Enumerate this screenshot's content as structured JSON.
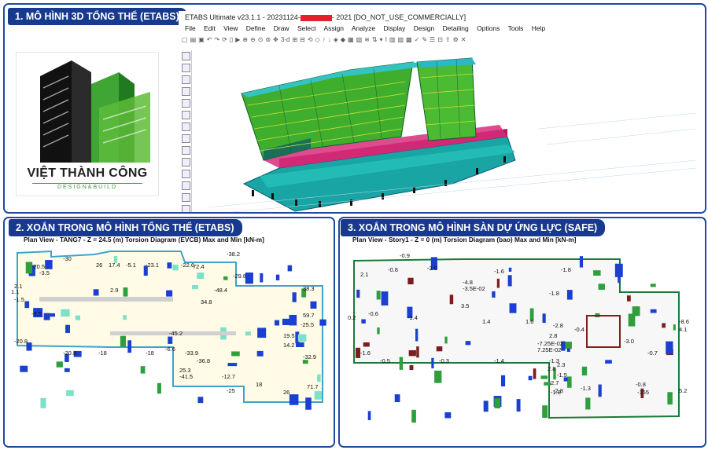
{
  "panels": {
    "p1": {
      "title": "1. MÔ HÌNH 3D TỔNG THỂ (ETABS)"
    },
    "p2": {
      "title": "2. XOẮN TRONG MÔ HÌNH TỔNG THỂ (ETABS)"
    },
    "p3": {
      "title": "3. XOẮN TRONG MÔ HÌNH SÀN DỰ ỨNG LỰC (SAFE)"
    }
  },
  "logo": {
    "name": "VIỆT THÀNH CÔNG",
    "tagline": "DESIGN&BUILD"
  },
  "etabs": {
    "title_left": "ETABS Ultimate v23.1.1 - 20231124-",
    "title_right": "- 2021  [DO_NOT_USE_COMMERCIALLY]",
    "menu": [
      "File",
      "Edit",
      "View",
      "Define",
      "Draw",
      "Select",
      "Assign",
      "Analyze",
      "Display",
      "Design",
      "Detailing",
      "Options",
      "Tools",
      "Help"
    ],
    "toolbar_3d": "3-d"
  },
  "plan2": {
    "header": "Plan View - TANG7 - Z = 24.5 (m)      Torsion Diagram   (EVCB)  Max and Min    [kN-m]",
    "labels": [
      "-30",
      "-20.5",
      "-3.5",
      "26",
      "17.4",
      "-5.1",
      "-23.1",
      "-22.6",
      "72.4",
      "-38.2",
      "-29.8",
      "2.1",
      "1.1",
      "-1.5",
      "-9.5",
      "2.9",
      "-48.4",
      "34.8",
      "38.3",
      "59.7",
      "-25.5",
      "-20.8",
      "-45.2",
      "-20.8",
      "-18",
      "-18",
      "-6.6",
      "-33.9",
      "-36.8",
      "19.5",
      "14.2",
      "-32.9",
      "25.3",
      "-41.5",
      "-12.7",
      "18",
      "71.7",
      "-25",
      "26"
    ]
  },
  "plan3": {
    "header": "Plan View - Story1 - Z = 0 (m)      Torsion Diagram   (bao)  Max and Min    [kN-m]",
    "labels": [
      "-0.9",
      "2.1",
      "-0.8",
      "-2.0",
      "-4.8",
      "-3.5E-02",
      "-1.6",
      "-1.8",
      "3.5",
      "0.2",
      "-0.6",
      "-1.4",
      "1.4",
      "1.6",
      "-2.8",
      "-0.4",
      "2.8",
      "4.1",
      "-7.25E-02",
      "7.25E-02",
      "-1.6",
      "-0.5",
      "-0.3",
      "-1.4",
      "-1.3",
      "2.3",
      "2.8",
      "-1.5",
      "2.7",
      "-1.8",
      "-0.7",
      "-1.3",
      "-2.8",
      "-0.8",
      "-155",
      "5.2",
      "-8.6",
      "-1.8",
      "-3.0"
    ]
  }
}
